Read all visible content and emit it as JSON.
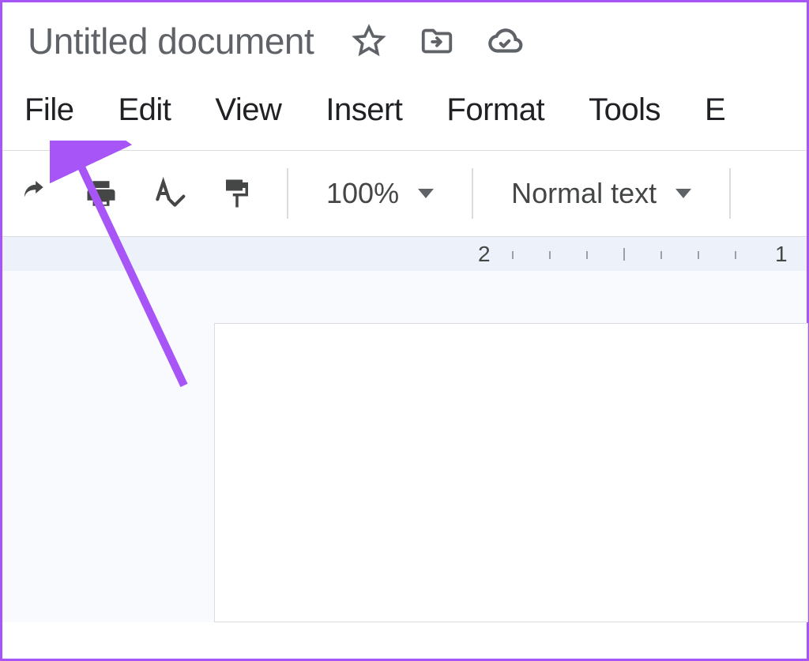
{
  "header": {
    "title": "Untitled document"
  },
  "menu": {
    "items": [
      "File",
      "Edit",
      "View",
      "Insert",
      "Format",
      "Tools",
      "E"
    ]
  },
  "toolbar": {
    "zoom": "100%",
    "style": "Normal text"
  },
  "ruler": {
    "labels": [
      "2",
      "1"
    ]
  }
}
